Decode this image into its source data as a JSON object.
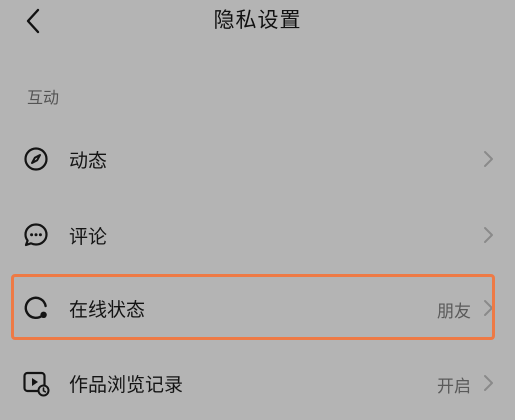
{
  "header": {
    "title": "隐私设置"
  },
  "section": {
    "title": "互动"
  },
  "items": [
    {
      "label": "动态",
      "value": "",
      "icon": "compass-icon"
    },
    {
      "label": "评论",
      "value": "",
      "icon": "comment-bubble-icon"
    },
    {
      "label": "在线状态",
      "value": "朋友",
      "icon": "online-status-icon"
    },
    {
      "label": "作品浏览记录",
      "value": "开启",
      "icon": "view-history-icon"
    }
  ],
  "colors": {
    "background": "#b4b4b4",
    "highlight": "#ee7a45"
  }
}
